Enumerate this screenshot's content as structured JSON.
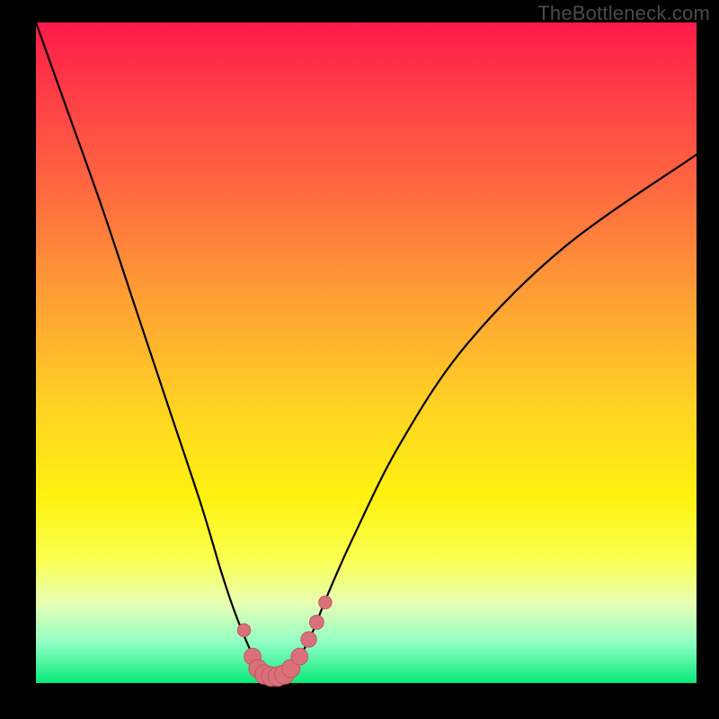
{
  "watermark": "TheBottleneck.com",
  "colors": {
    "background": "#000000",
    "curve": "#000000",
    "marker_fill": "#d9717b",
    "marker_stroke": "#c55560",
    "gradient_top": "#ff1a4b",
    "gradient_bottom": "#08e97a"
  },
  "chart_data": {
    "type": "line",
    "title": "",
    "xlabel": "",
    "ylabel": "",
    "xlim": [
      0,
      100
    ],
    "ylim": [
      0,
      100
    ],
    "grid": false,
    "legend": false,
    "series": [
      {
        "name": "bottleneck-curve",
        "x": [
          0,
          5,
          10,
          15,
          20,
          25,
          28,
          30,
          32,
          33,
          34,
          35,
          36,
          37,
          38,
          39,
          40,
          42,
          44,
          48,
          55,
          65,
          80,
          100
        ],
        "y": [
          100,
          86,
          72,
          57,
          42,
          27,
          17,
          11,
          6,
          4,
          2.5,
          1.5,
          1,
          1,
          1.5,
          2.5,
          4,
          8,
          13,
          22,
          36,
          51,
          66,
          80
        ]
      }
    ],
    "markers": [
      {
        "x": 31.5,
        "y": 8.0,
        "r": 1.0
      },
      {
        "x": 32.8,
        "y": 4.0,
        "r": 1.3
      },
      {
        "x": 33.6,
        "y": 2.2,
        "r": 1.4
      },
      {
        "x": 34.6,
        "y": 1.3,
        "r": 1.5
      },
      {
        "x": 35.6,
        "y": 1.0,
        "r": 1.5
      },
      {
        "x": 36.6,
        "y": 1.0,
        "r": 1.5
      },
      {
        "x": 37.6,
        "y": 1.3,
        "r": 1.5
      },
      {
        "x": 38.6,
        "y": 2.2,
        "r": 1.4
      },
      {
        "x": 39.9,
        "y": 4.0,
        "r": 1.3
      },
      {
        "x": 41.3,
        "y": 6.6,
        "r": 1.2
      },
      {
        "x": 42.5,
        "y": 9.2,
        "r": 1.1
      },
      {
        "x": 43.8,
        "y": 12.2,
        "r": 1.0
      }
    ]
  }
}
